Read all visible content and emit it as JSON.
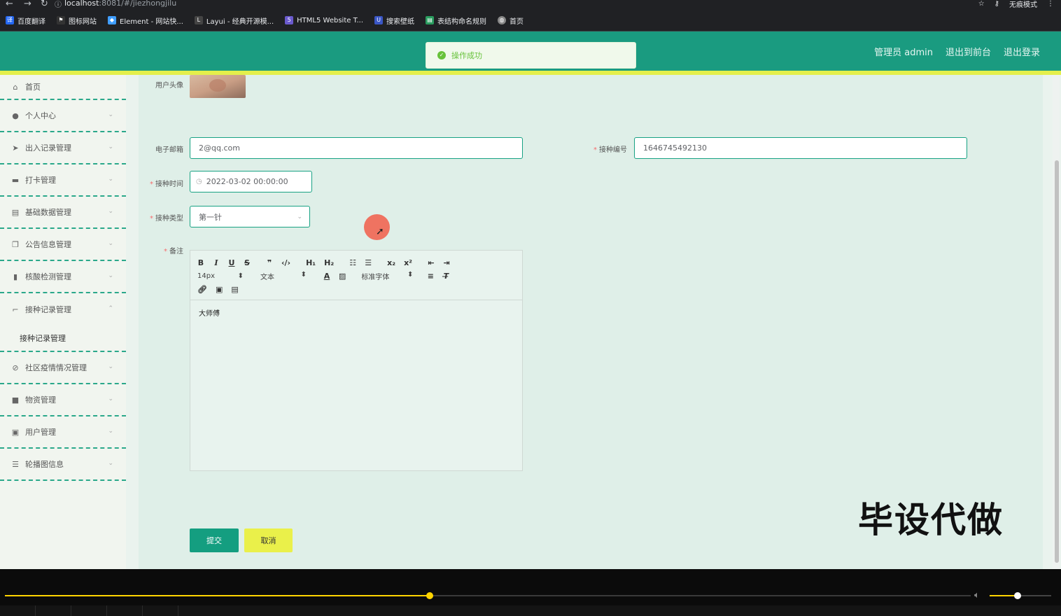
{
  "browser": {
    "url_host": "localhost",
    "url_rest": ":8081/#/jiezhongjilu",
    "profile_label": "无痕模式",
    "bookmarks": [
      {
        "label": "百度翻译",
        "icon": "baidu-translate-icon",
        "color": "#2468f2"
      },
      {
        "label": "图标网站",
        "icon": "flag-icon",
        "color": "#333333"
      },
      {
        "label": "Element - 网站快...",
        "icon": "element-icon",
        "color": "#409eff"
      },
      {
        "label": "Layui - 经典开源模...",
        "icon": "layui-icon",
        "color": "#444444"
      },
      {
        "label": "HTML5 Website T...",
        "icon": "html5-icon",
        "color": "#6a5acd"
      },
      {
        "label": "搜索壁纸",
        "icon": "wallpaper-icon",
        "color": "#3a56c5"
      },
      {
        "label": "表结构命名规则",
        "icon": "table-icon",
        "color": "#2a9d5f"
      },
      {
        "label": "首页",
        "icon": "globe-icon",
        "color": "#888888"
      }
    ]
  },
  "header": {
    "admin_label": "管理员 admin",
    "front_label": "退出到前台",
    "logout_label": "退出登录"
  },
  "toast": {
    "message": "操作成功"
  },
  "sidebar": {
    "items": [
      {
        "label": "首页",
        "icon": "home-icon"
      },
      {
        "label": "个人中心",
        "icon": "user-icon"
      },
      {
        "label": "出入记录管理",
        "icon": "send-icon"
      },
      {
        "label": "打卡管理",
        "icon": "briefcase-icon"
      },
      {
        "label": "基础数据管理",
        "icon": "document-icon"
      },
      {
        "label": "公告信息管理",
        "icon": "copy-icon"
      },
      {
        "label": "核酸检测管理",
        "icon": "chart-icon"
      },
      {
        "label": "接种记录管理",
        "icon": "crop-icon"
      },
      {
        "label": "社区疫情情况管理",
        "icon": "no-smoking-icon"
      },
      {
        "label": "物资管理",
        "icon": "box-icon"
      },
      {
        "label": "用户管理",
        "icon": "clipboard-icon"
      },
      {
        "label": "轮播图信息",
        "icon": "sliders-icon"
      }
    ],
    "submenu_label": "接种记录管理"
  },
  "form": {
    "avatar_label": "用户头像",
    "email_label": "电子邮箱",
    "email_value": "2@qq.com",
    "number_label": "接种编号",
    "number_value": "1646745492130",
    "time_label": "接种时间",
    "time_value": "2022-03-02 00:00:00",
    "type_label": "接种类型",
    "type_value": "第一针",
    "remark_label": "备注",
    "editor": {
      "font_size": "14px",
      "paragraph": "文本",
      "font_family": "标准字体",
      "content": "大师傅"
    },
    "submit_label": "提交",
    "cancel_label": "取消"
  },
  "watermark": "毕设代做",
  "player": {
    "progress": 0.44,
    "volume": 0.45
  }
}
